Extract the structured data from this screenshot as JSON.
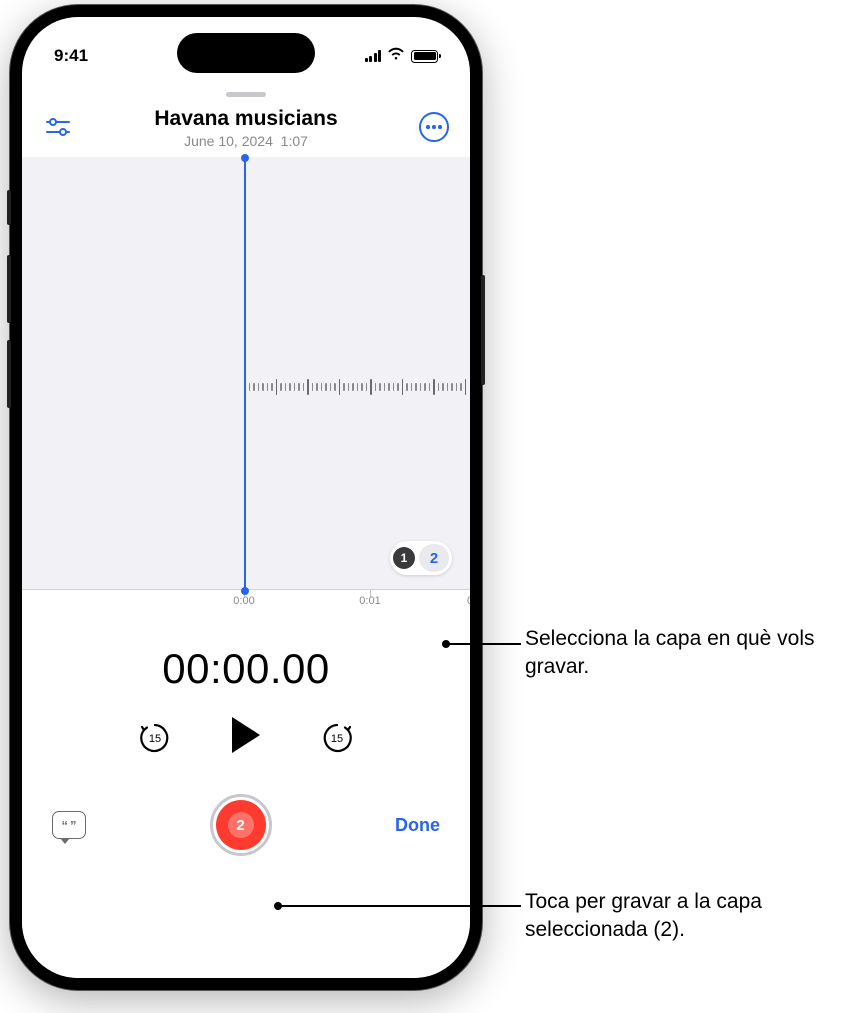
{
  "status": {
    "time": "9:41"
  },
  "header": {
    "title": "Havana musicians",
    "date": "June 10, 2024",
    "duration": "1:07"
  },
  "icons": {
    "adjust": "adjust-sliders-icon",
    "more": "more-options-icon"
  },
  "ruler": {
    "marks": [
      "0:00",
      "0:01",
      "0"
    ]
  },
  "layers": {
    "opt1": "1",
    "opt2": "2",
    "selected": 2
  },
  "timer": "00:00.00",
  "transport": {
    "skip_back": "15",
    "skip_forward": "15"
  },
  "record": {
    "layer_badge": "2"
  },
  "done_label": "Done",
  "transcript": {
    "q1": "“",
    "q2": "”"
  },
  "callouts": {
    "c1": "Selecciona la capa en què vols gravar.",
    "c2": "Toca per gravar a la capa seleccionada (2)."
  }
}
